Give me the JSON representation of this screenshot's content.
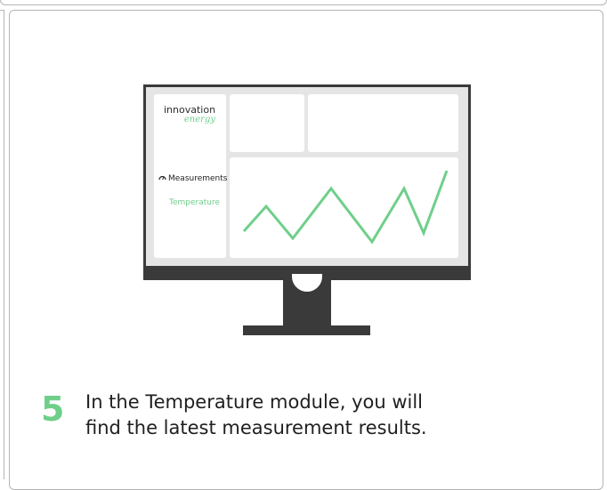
{
  "screen": {
    "logo_line1": "innovation",
    "logo_line2": "energy",
    "menu_measurements": "Measurements",
    "menu_temperature": "Temperature"
  },
  "step": {
    "number": "5",
    "line1": "In the Temperature module, you will",
    "line2": "find the latest measurement results."
  },
  "colors": {
    "accent_green": "#6fcf8a",
    "monitor_dark": "#3a3a3a",
    "screen_bg": "#e5e5e5"
  }
}
